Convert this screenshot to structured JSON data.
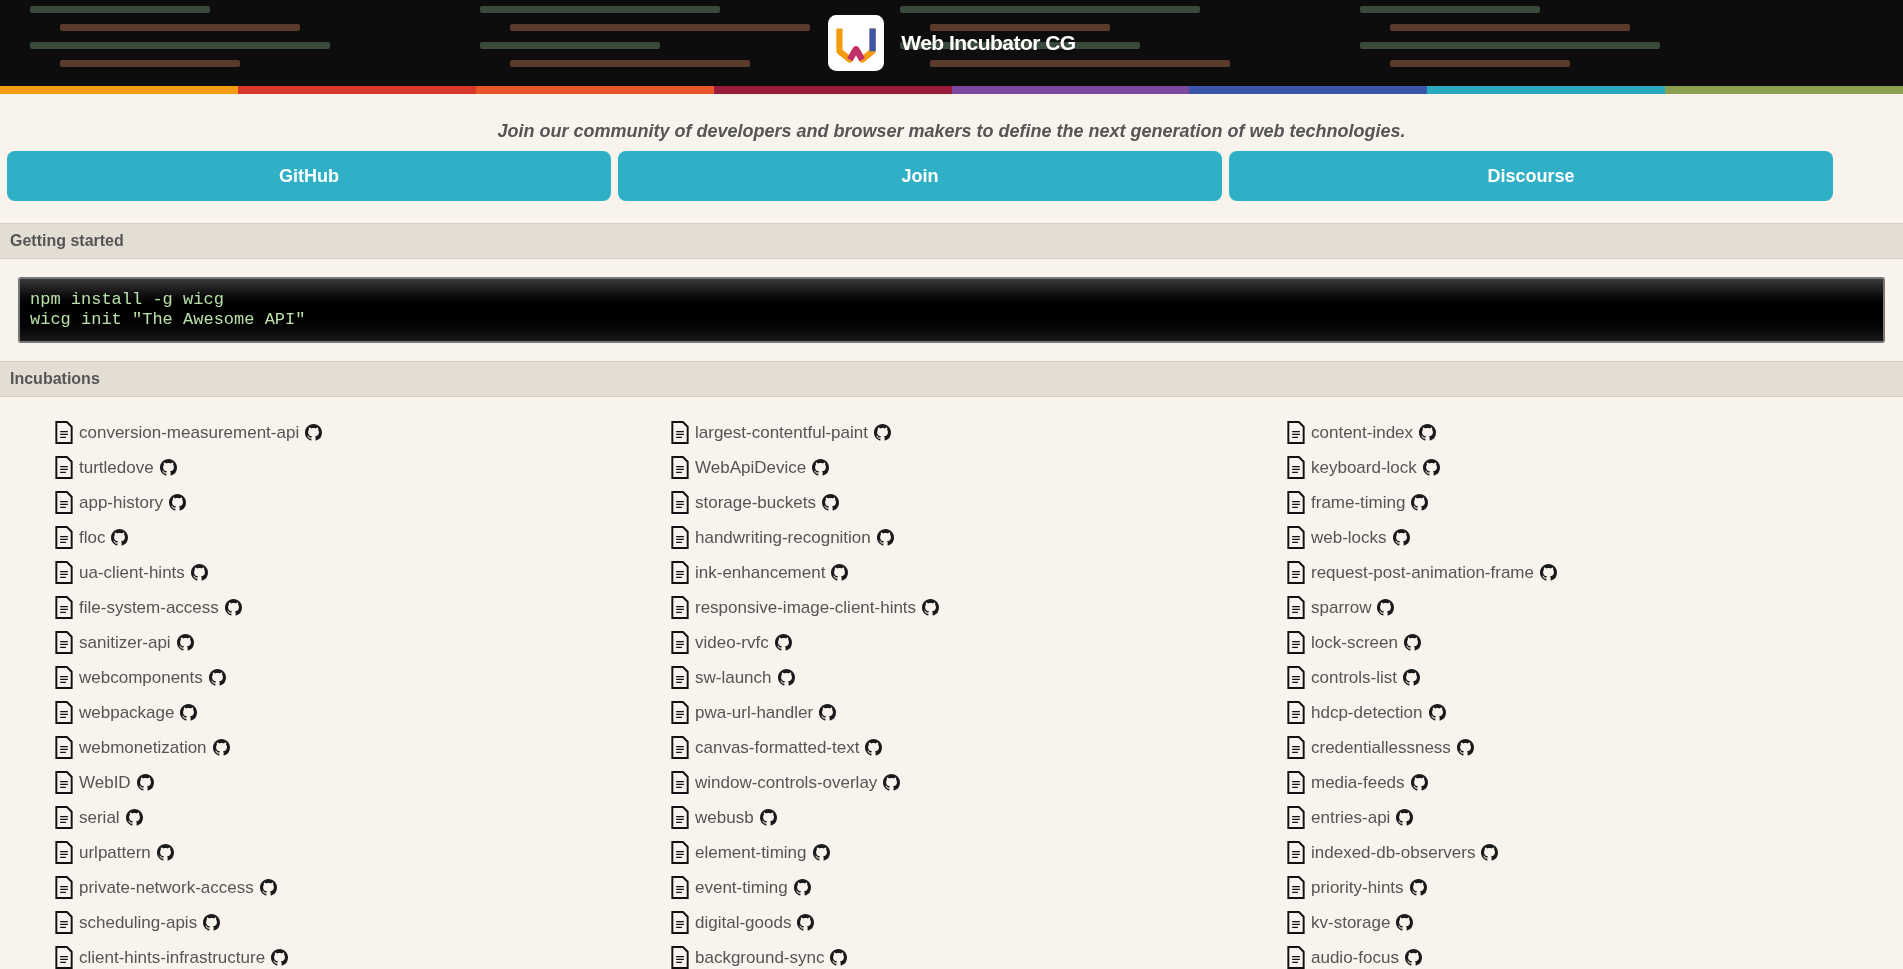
{
  "header": {
    "title": "Web Incubator CG"
  },
  "tagline": "Join our community of developers and browser makers to define the next generation of web technologies.",
  "buttons": [
    "GitHub",
    "Join",
    "Discourse"
  ],
  "getting_started": {
    "title": "Getting started",
    "code": [
      "npm install -g wicg",
      "wicg init \"The Awesome API\""
    ]
  },
  "incubations": {
    "title": "Incubations",
    "columns": [
      [
        "conversion-measurement-api",
        "turtledove",
        "app-history",
        "floc",
        "ua-client-hints",
        "file-system-access",
        "sanitizer-api",
        "webcomponents",
        "webpackage",
        "webmonetization",
        "WebID",
        "serial",
        "urlpattern",
        "private-network-access",
        "scheduling-apis",
        "client-hints-infrastructure"
      ],
      [
        "largest-contentful-paint",
        "WebApiDevice",
        "storage-buckets",
        "handwriting-recognition",
        "ink-enhancement",
        "responsive-image-client-hints",
        "video-rvfc",
        "sw-launch",
        "pwa-url-handler",
        "canvas-formatted-text",
        "window-controls-overlay",
        "webusb",
        "element-timing",
        "event-timing",
        "digital-goods",
        "background-sync"
      ],
      [
        "content-index",
        "keyboard-lock",
        "frame-timing",
        "web-locks",
        "request-post-animation-frame",
        "sparrow",
        "lock-screen",
        "controls-list",
        "hdcp-detection",
        "credentiallessness",
        "media-feeds",
        "entries-api",
        "indexed-db-observers",
        "priority-hints",
        "kv-storage",
        "audio-focus"
      ]
    ]
  }
}
